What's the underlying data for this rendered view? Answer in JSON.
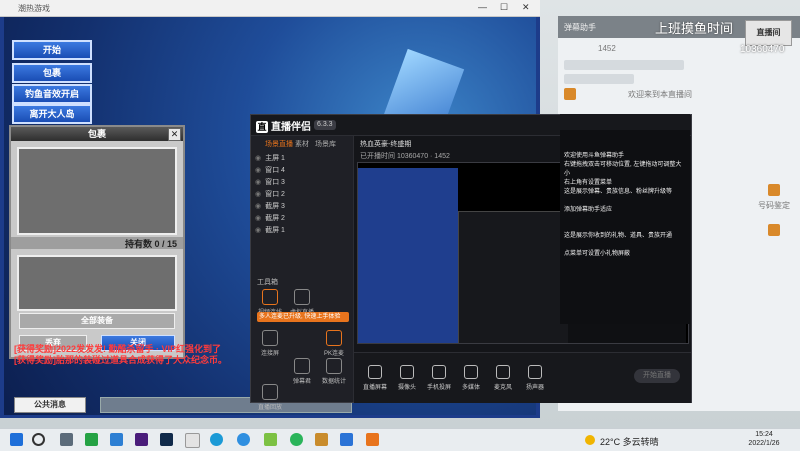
{
  "game": {
    "window_title": "潮热游戏",
    "buttons": [
      "开始",
      "包裹",
      "钓鱼音效开启",
      "离开大人岛"
    ],
    "bag": {
      "title": "包裹",
      "count_label": "持有数 0 / 15",
      "sort_label": "全部装备",
      "discard_label": "丢弃",
      "close_label": "关闭"
    },
    "chat_lines": [
      "[获得奖励]2022发发发! 勤酷杀留手 · VIP红强化到了",
      "[获得奖励]胎那的装碰过道具合成获得了大众纪念币。"
    ],
    "public_message_label": "公共消息"
  },
  "stream_app": {
    "name": "直播伴侣",
    "version": "6.3.3",
    "sidebar_tabs": [
      "场景直播",
      "素材",
      "场景库"
    ],
    "scenes": [
      "主屏 1",
      "窗口 4",
      "窗口 3",
      "窗口 2",
      "截屏 3",
      "截屏 2",
      "截屏 1"
    ],
    "tools_label": "工具箱",
    "tip": "多人连麦已升级, 快速上手体验",
    "tools": [
      "视频连线",
      "虚拟直播",
      "连接屏",
      "PK连麦",
      "弹幕君",
      "数据统计",
      "直播回放"
    ],
    "live_title": "热血英豪-终盛期",
    "live_status": "已开播时间 10360470 · 1452",
    "bottom_buttons": [
      "直播屏幕",
      "摄像头",
      "手机投屏",
      "多媒体",
      "麦克风",
      "扬声器"
    ],
    "start_button": "开始直播"
  },
  "help_overlay": {
    "lines": [
      "欢迎使用斗鱼弹幕助手",
      "右键拖拽双击可移动位置, 左键拖动可调整大小",
      "右上角有设置菜单",
      "这是展示弹幕、贵族信息、粉丝牌升级等",
      "添加弹幕助手适应",
      "这是展示你收到的礼物、道具、贵族开通",
      "点菜单可设置小礼物屏蔽"
    ]
  },
  "overlay": {
    "title": "上班摸鱼时间",
    "room_id": "10360470",
    "brand": "直播间"
  },
  "right_panel": {
    "title": "弹幕助手",
    "count": "1452",
    "follower_line": "欢迎来到本直播间",
    "side_label": "号码鉴定"
  },
  "taskbar": {
    "weather": "22°C 多云转晴",
    "time": "15:24",
    "date": "2022/1/26"
  },
  "colors": {
    "accent_orange": "#e8741d",
    "game_blue": "#1d3c8a",
    "app_dark": "#1c1d22"
  }
}
